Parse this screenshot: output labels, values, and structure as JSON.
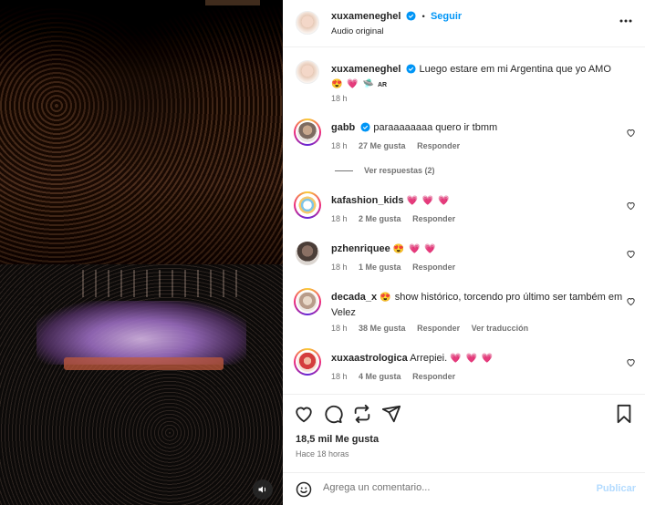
{
  "post": {
    "username": "xuxameneghel",
    "follow_label": "Seguir",
    "bullet": "•",
    "subtitle": "Audio original",
    "more_icon": "more-horizontal-icon"
  },
  "caption": {
    "username": "xuxameneghel",
    "text": "Luego estare em mi Argentina que yo AMO",
    "emojis": "😍 💗 🛸",
    "flag_text": "AR",
    "time": "18 h"
  },
  "comments": [
    {
      "username": "gabb",
      "verified": true,
      "text": "paraaaaaaaa quero ir tbmm",
      "time": "18 h",
      "likes": "27 Me gusta",
      "reply": "Responder",
      "view_replies": "Ver respuestas (2)"
    },
    {
      "username": "kafashion_kids",
      "verified": false,
      "text": "",
      "emojis": "💗 💗 💗",
      "time": "18 h",
      "likes": "2 Me gusta",
      "reply": "Responder"
    },
    {
      "username": "pzhenriquee",
      "verified": false,
      "text": "",
      "emojis": "😍 💗 💗",
      "time": "18 h",
      "likes": "1 Me gusta",
      "reply": "Responder"
    },
    {
      "username": "decada_x",
      "verified": false,
      "emojis": "😍",
      "text": "show histórico, torcendo pro último ser também em Velez",
      "time": "18 h",
      "likes": "38 Me gusta",
      "reply": "Responder",
      "translate": "Ver traducción"
    },
    {
      "username": "xuxaastrologica",
      "verified": false,
      "text": "Arrepiei.",
      "emojis": "💗 💗 💗",
      "time": "18 h",
      "likes": "4 Me gusta",
      "reply": "Responder"
    }
  ],
  "actions": {
    "likes_count": "18,5 mil Me gusta",
    "posted_ago": "Hace 18 horas"
  },
  "composer": {
    "placeholder": "Agrega un comentario...",
    "publish_label": "Publicar"
  },
  "colors": {
    "accent": "#0095f6",
    "verified": "#0095f6",
    "heart_emoji": "#ed4956",
    "publish_disabled": "#b3dbff"
  }
}
